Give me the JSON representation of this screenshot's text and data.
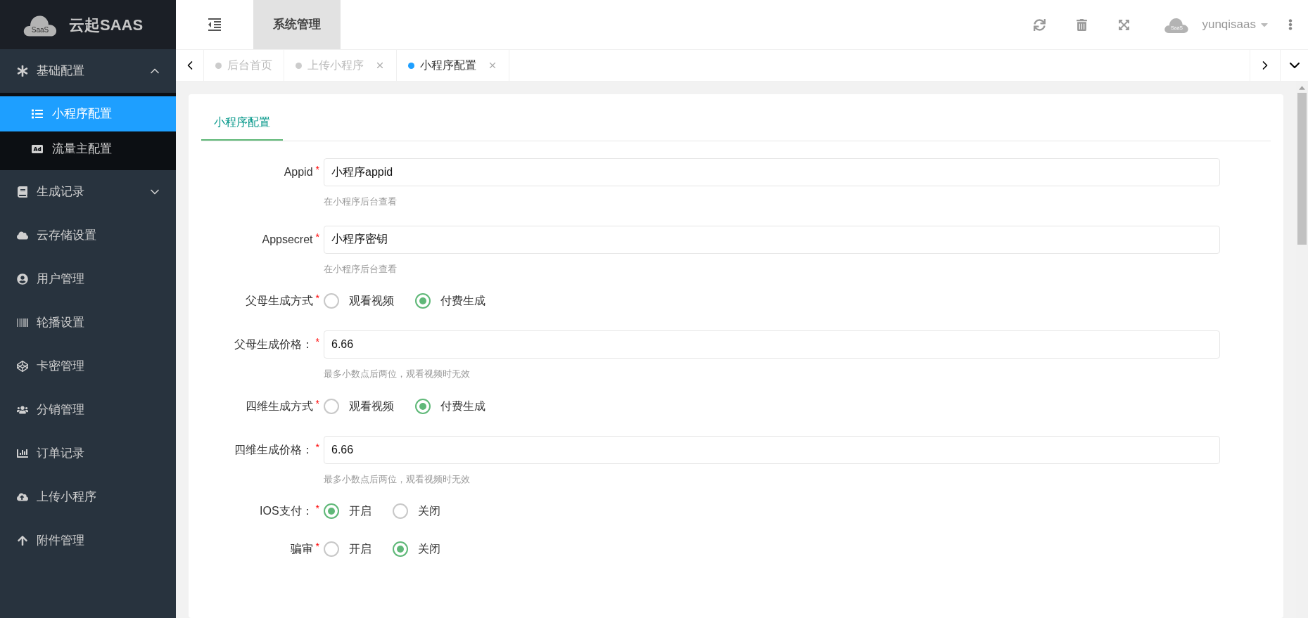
{
  "logo": {
    "badge": "SaaS",
    "text": "云起SAAS"
  },
  "sidebar": {
    "items": [
      {
        "label": "基础配置",
        "selected": false,
        "expanded": true,
        "children": [
          {
            "label": "小程序配置",
            "selected": true
          },
          {
            "label": "流量主配置",
            "selected": false
          }
        ]
      },
      {
        "label": "生成记录",
        "selected": false,
        "expanded": false
      },
      {
        "label": "云存储设置",
        "selected": false
      },
      {
        "label": "用户管理",
        "selected": false
      },
      {
        "label": "轮播设置",
        "selected": false
      },
      {
        "label": "卡密管理",
        "selected": false
      },
      {
        "label": "分销管理",
        "selected": false
      },
      {
        "label": "订单记录",
        "selected": false
      },
      {
        "label": "上传小程序",
        "selected": false
      },
      {
        "label": "附件管理",
        "selected": false
      }
    ]
  },
  "header": {
    "menu_tab": {
      "label": "系统管理",
      "selected": true
    },
    "user": {
      "badge": "SaaS",
      "name": "yunqisaas"
    }
  },
  "tabs": [
    {
      "label": "后台首页",
      "closable": false,
      "selected": false
    },
    {
      "label": "上传小程序",
      "closable": true,
      "selected": false
    },
    {
      "label": "小程序配置",
      "closable": true,
      "selected": true
    }
  ],
  "form": {
    "tab": {
      "label": "小程序配置",
      "selected": true
    },
    "fields": [
      {
        "kind": "text",
        "label": "Appid",
        "required_mark": "*",
        "value": "小程序appid",
        "help": "在小程序后台查看"
      },
      {
        "kind": "text",
        "label": "Appsecret",
        "required_mark": "*",
        "value": "小程序密钥",
        "help": "在小程序后台查看"
      },
      {
        "kind": "radio",
        "label": "父母生成方式",
        "required_mark": "*",
        "options": [
          {
            "label": "观看视频",
            "selected": false
          },
          {
            "label": "付费生成",
            "selected": true
          }
        ]
      },
      {
        "kind": "text",
        "label": "父母生成价格：",
        "required_mark": "*",
        "value": "6.66",
        "help": "最多小数点后两位，观看视频时无效"
      },
      {
        "kind": "radio",
        "label": "四维生成方式",
        "required_mark": "*",
        "options": [
          {
            "label": "观看视频",
            "selected": false
          },
          {
            "label": "付费生成",
            "selected": true
          }
        ]
      },
      {
        "kind": "text",
        "label": "四维生成价格：",
        "required_mark": "*",
        "value": "6.66",
        "help": "最多小数点后两位，观看视频时无效"
      },
      {
        "kind": "radio",
        "label": "IOS支付：",
        "required_mark": "*",
        "options": [
          {
            "label": "开启",
            "selected": true
          },
          {
            "label": "关闭",
            "selected": false
          }
        ]
      },
      {
        "kind": "radio",
        "label": "骗审",
        "required_mark": "*",
        "options": [
          {
            "label": "开启",
            "selected": false
          },
          {
            "label": "关闭",
            "selected": true
          }
        ]
      }
    ]
  }
}
